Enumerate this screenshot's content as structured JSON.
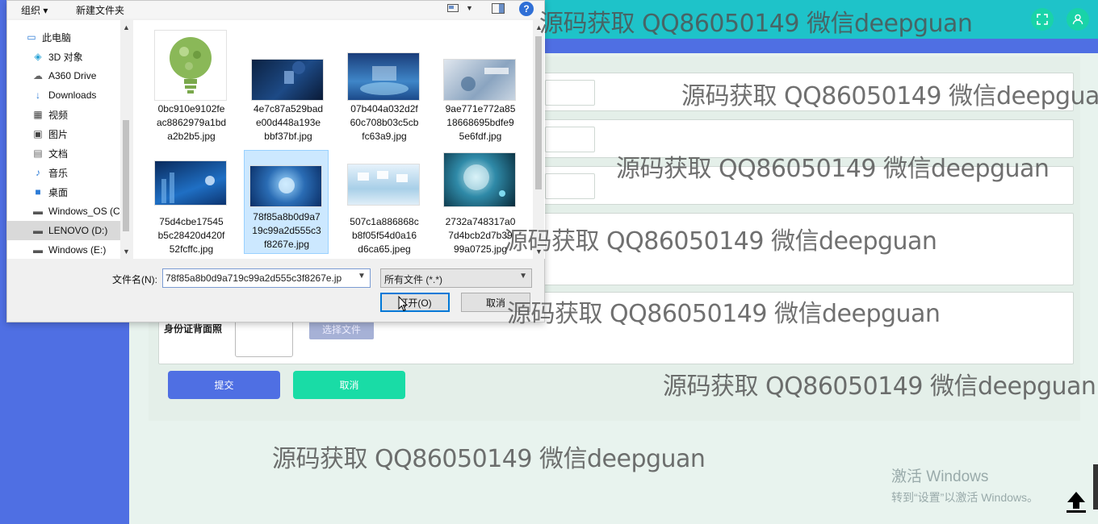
{
  "app": {
    "colors": {
      "sidebar": "#4f6fe3",
      "header": "#1ec3c9",
      "accent_green": "#19dca6"
    },
    "header_icons": [
      "fullscreen-icon",
      "user-icon"
    ],
    "form": {
      "id_back_label": "身份证背面照",
      "choose_file": "选择文件",
      "submit": "提交",
      "cancel": "取消"
    },
    "activate": {
      "line1": "激活 Windows",
      "line2": "转到“设置”以激活 Windows。"
    }
  },
  "watermark": "源码获取 QQ86050149 微信deepguan",
  "dialog": {
    "toolbar": {
      "organize": "组织 ▾",
      "new_folder": "新建文件夹"
    },
    "nav": [
      {
        "label": "此电脑",
        "icon": "pc-icon"
      },
      {
        "label": "3D 对象",
        "icon": "cube-icon"
      },
      {
        "label": "A360 Drive",
        "icon": "cloud-drive-icon"
      },
      {
        "label": "Downloads",
        "icon": "download-icon"
      },
      {
        "label": "视频",
        "icon": "video-icon"
      },
      {
        "label": "图片",
        "icon": "picture-icon"
      },
      {
        "label": "文档",
        "icon": "document-icon"
      },
      {
        "label": "音乐",
        "icon": "music-icon"
      },
      {
        "label": "桌面",
        "icon": "desktop-icon"
      },
      {
        "label": "Windows_OS (C",
        "icon": "drive-icon"
      },
      {
        "label": "LENOVO (D:)",
        "icon": "drive-icon"
      },
      {
        "label": "Windows (E:)",
        "icon": "drive-icon"
      }
    ],
    "files": [
      {
        "line1": "0bc910e9102fe",
        "line2": "ac8862979a1bd",
        "line3": "a2b2b5.jpg"
      },
      {
        "line1": "4e7c87a529bad",
        "line2": "e00d448a193e",
        "line3": "bbf37bf.jpg"
      },
      {
        "line1": "07b404a032d2f",
        "line2": "60c708b03c5cb",
        "line3": "fc63a9.jpg"
      },
      {
        "line1": "9ae771e772a85",
        "line2": "18668695bdfe9",
        "line3": "5e6fdf.jpg"
      },
      {
        "line1": "75d4cbe17545",
        "line2": "b5c28420d420f",
        "line3": "52fcffc.jpg"
      },
      {
        "line1": "78f85a8b0d9a7",
        "line2": "19c99a2d555c3",
        "line3": "f8267e.jpg"
      },
      {
        "line1": "507c1a886868c",
        "line2": "b8f05f54d0a16",
        "line3": "d6ca65.jpeg"
      },
      {
        "line1": "2732a748317a0",
        "line2": "7d4bcb2d7b39",
        "line3": "99a0725.jpg"
      }
    ],
    "filename_label": "文件名(N):",
    "filename_value": "78f85a8b0d9a719c99a2d555c3f8267e.jp",
    "filetype": "所有文件 (*.*)",
    "open": "打开(O)",
    "cancel": "取消"
  }
}
